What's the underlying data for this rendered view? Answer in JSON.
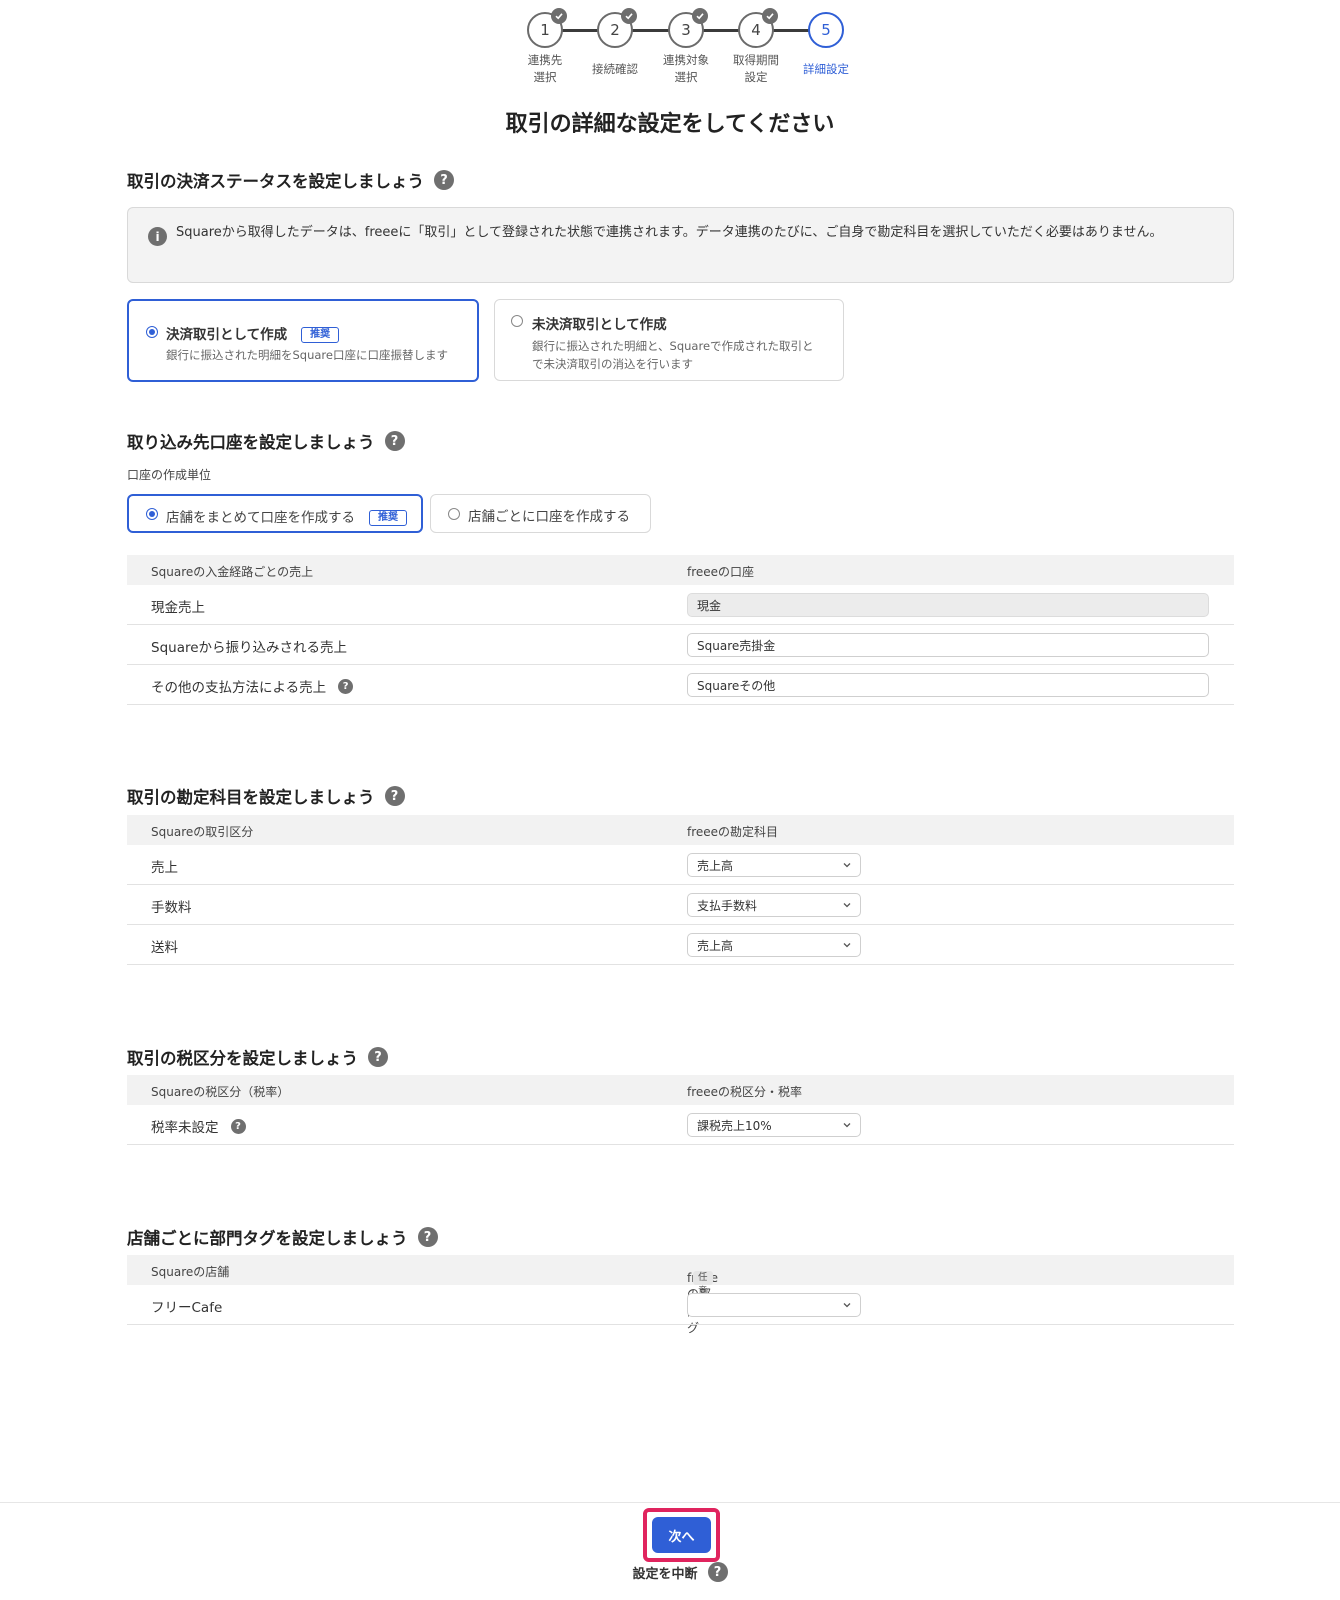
{
  "stepper": {
    "steps": [
      {
        "number": "1",
        "label": "連携先\n選択",
        "done": true
      },
      {
        "number": "2",
        "label": "接続確認",
        "done": true
      },
      {
        "number": "3",
        "label": "連携対象\n選択",
        "done": true
      },
      {
        "number": "4",
        "label": "取得期間\n設定",
        "done": true
      },
      {
        "number": "5",
        "label": "詳細設定",
        "done": false
      }
    ]
  },
  "page": {
    "title": "取引の詳細な設定をしてください"
  },
  "status_section": {
    "heading": "取引の決済ステータスを設定しましょう",
    "info": "Squareから取得したデータは、freeeに「取引」として登録された状態で連携されます。データ連携のたびに、ご自身で勘定科目を選択していただく必要はありません。",
    "options": [
      {
        "title": "決済取引として作成",
        "badge": "推奨",
        "desc": "銀行に振込された明細をSquare口座に口座振替します",
        "selected": true
      },
      {
        "title": "未決済取引として作成",
        "desc": "銀行に振込された明細と、Squareで作成された取引と\nで未決済取引の消込を行います",
        "selected": false
      }
    ]
  },
  "account_section": {
    "heading": "取り込み先口座を設定しましょう",
    "unit_label": "口座の作成単位",
    "unit_options": [
      {
        "label": "店舗をまとめて口座を作成する",
        "badge": "推奨",
        "selected": true
      },
      {
        "label": "店舗ごとに口座を作成する",
        "selected": false
      }
    ],
    "table": {
      "col_left": "Squareの入金経路ごとの売上",
      "col_right": "freeeの口座",
      "rows": [
        {
          "label": "現金売上",
          "value": "現金",
          "readonly": true
        },
        {
          "label": "Squareから振り込みされる売上",
          "value": "Square売掛金"
        },
        {
          "label": "その他の支払方法による売上",
          "value": "Squareその他",
          "help": true
        }
      ]
    }
  },
  "item_section": {
    "heading": "取引の勘定科目を設定しましょう",
    "table": {
      "col_left": "Squareの取引区分",
      "col_right": "freeeの勘定科目",
      "rows": [
        {
          "label": "売上",
          "value": "売上高"
        },
        {
          "label": "手数料",
          "value": "支払手数料"
        },
        {
          "label": "送料",
          "value": "売上高"
        }
      ]
    }
  },
  "tax_section": {
    "heading": "取引の税区分を設定しましょう",
    "table": {
      "col_left": "Squareの税区分（税率）",
      "col_right": "freeeの税区分・税率",
      "rows": [
        {
          "label": "税率未設定",
          "value": "課税売上10%",
          "help": true
        }
      ]
    }
  },
  "dept_section": {
    "heading": "店舗ごとに部門タグを設定しましょう",
    "table": {
      "col_left": "Squareの店舗",
      "col_right": "freeeの部門タグ",
      "optional_badge": "任意",
      "rows": [
        {
          "label": "フリーCafe",
          "value": ""
        }
      ]
    }
  },
  "footer": {
    "next_label": "次へ",
    "suspend_label": "設定を中断"
  },
  "colors": {
    "accent": "#2f5fd6",
    "highlight": "#e0245e"
  },
  "icons": {
    "help": "question-circle-icon",
    "info": "info-circle-icon",
    "check": "check-icon",
    "select": "chevron-down-icon"
  }
}
